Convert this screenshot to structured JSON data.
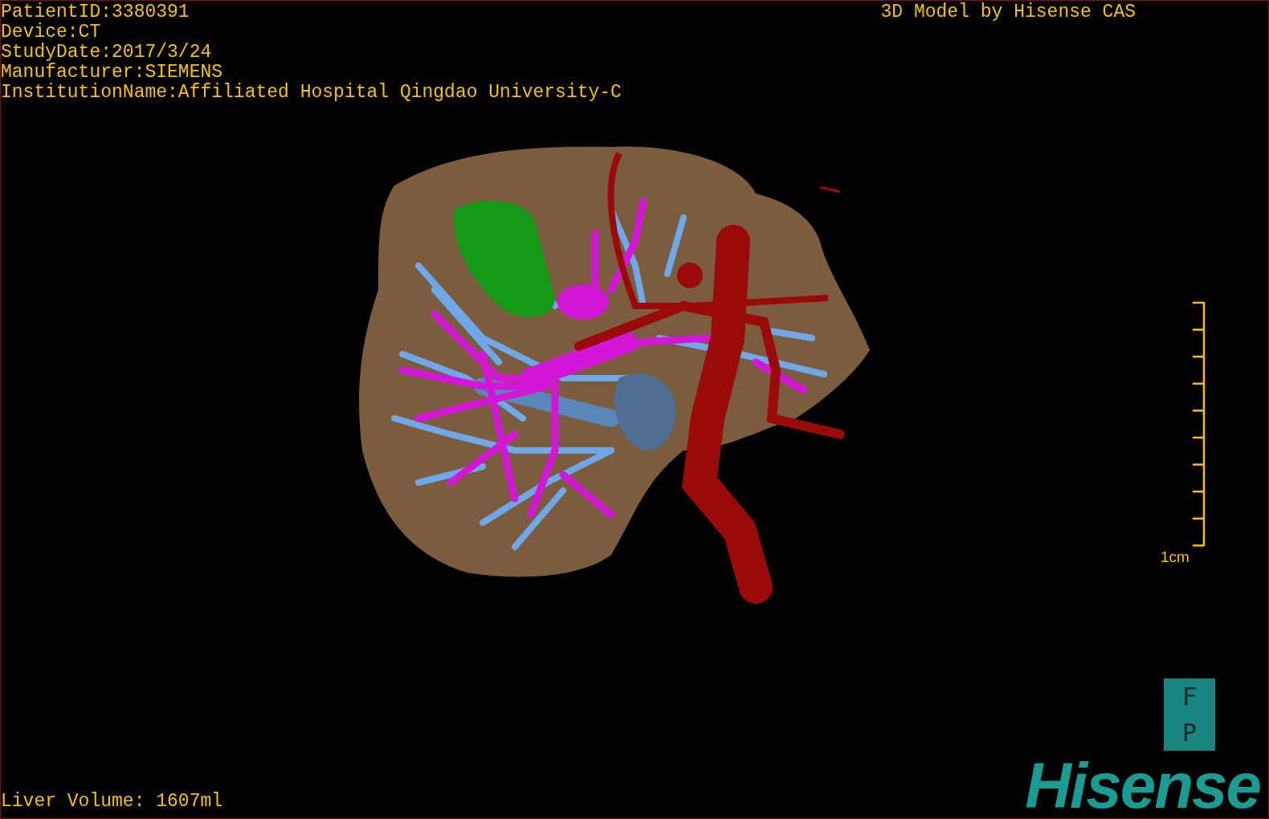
{
  "patient_info": [
    "PatientID:3380391",
    "Device:CT",
    "StudyDate:2017/3/24",
    "Manufacturer:SIEMENS",
    "InstitutionName:Affiliated Hospital Qingdao University-C"
  ],
  "model_credit": "3D Model by Hisense CAS",
  "scale_bar": {
    "label": "1cm"
  },
  "orientation_box": {
    "top": "F",
    "bottom": "P"
  },
  "liver_volume": "Liver Volume: 1607ml",
  "logo": "Hisense"
}
